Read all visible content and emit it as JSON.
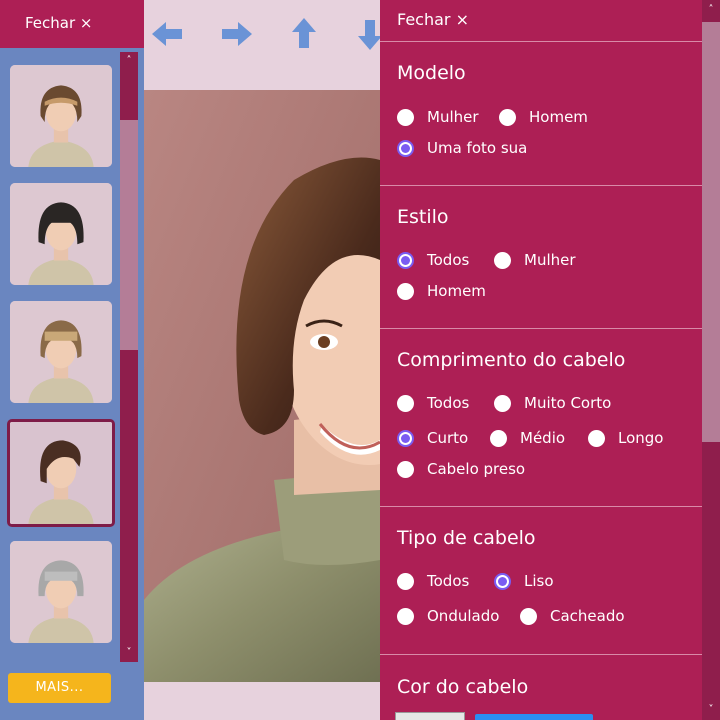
{
  "left_panel": {
    "close_label": "Fechar ×",
    "more_label": "MAIS...",
    "scroll_up": "˄",
    "scroll_down": "˅"
  },
  "right_panel": {
    "close_label": "Fechar ×",
    "sections": [
      {
        "title": "Modelo",
        "options": [
          {
            "label": "Mulher",
            "checked": false
          },
          {
            "label": "Homem",
            "checked": false
          },
          {
            "label": "Uma foto sua",
            "checked": true
          }
        ]
      },
      {
        "title": "Estilo",
        "options": [
          {
            "label": "Todos",
            "checked": true
          },
          {
            "label": "Mulher",
            "checked": false
          },
          {
            "label": "Homem",
            "checked": false
          }
        ]
      },
      {
        "title": "Comprimento do cabelo",
        "options": [
          {
            "label": "Todos",
            "checked": false
          },
          {
            "label": "Muito Corto",
            "checked": false
          },
          {
            "label": "Curto",
            "checked": true
          },
          {
            "label": "Médio",
            "checked": false
          },
          {
            "label": "Longo",
            "checked": false
          },
          {
            "label": "Cabelo preso",
            "checked": false
          }
        ]
      },
      {
        "title": "Tipo de cabelo",
        "options": [
          {
            "label": "Todos",
            "checked": false
          },
          {
            "label": "Liso",
            "checked": true
          },
          {
            "label": "Ondulado",
            "checked": false
          },
          {
            "label": "Cacheado",
            "checked": false
          }
        ]
      },
      {
        "title": "Cor do cabelo",
        "options": []
      }
    ]
  },
  "colors": {
    "panel": "#ad1f55",
    "sidebar": "#6a86c0",
    "background": "#e7d2dd",
    "radio_accent": "#7a5cf2",
    "more_button": "#f5b51c",
    "arrow": "#6a93d6"
  },
  "icons": [
    "arrow-left-icon",
    "arrow-right-icon",
    "arrow-up-icon",
    "arrow-down-icon"
  ]
}
